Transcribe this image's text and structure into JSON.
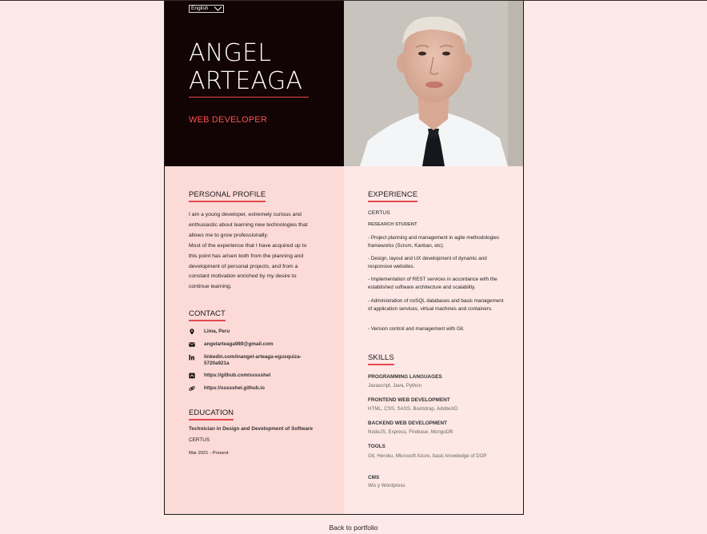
{
  "header": {
    "language": "English",
    "first_name": "ANGEL",
    "last_name": "ARTEAGA",
    "role": "WEB DEVELOPER"
  },
  "profile": {
    "title": "PERSONAL PROFILE",
    "lines": [
      "I am a young developer, extremely curious and",
      "enthusiastic about learning new technologies that",
      "allows me to grow professionally.",
      "Most of the experience that I have acquired up to",
      "this point has arisen both from the planning and",
      "development of personal projects, and from a",
      "constant motivation enriched by my desire to",
      "continue learning."
    ]
  },
  "contact": {
    "title": "CONTACT",
    "location": "Lima, Peru",
    "email": "angelarteaga989@gmail.com",
    "linkedin_line1": "linkedin.com/inangel-arteaga-egusquiza-",
    "linkedin_line2": "5720a921a",
    "github": "https://github.com/ssssshel",
    "website": "https://ssssshel.github.io"
  },
  "education": {
    "title": "EDUCATION",
    "degree": "Technician in Design and Development of Software",
    "school": "CERTUS",
    "dates": "Mar 2021 - Present"
  },
  "experience": {
    "title": "EXPERIENCE",
    "company": "CERTUS",
    "position": "RESEARCH STUDENT",
    "items": [
      "- Project planning and management in agile methodologies frameworks (Scrum, Kanban, etc).",
      "- Design, layout and UX development of dynamic and responsive websites.",
      "- Implementation of REST services in accordance with the established software architecture and scalability.",
      "- Administration of noSQL databases and basic management of application services, virtual machines and containers.",
      "- Version control and management with Git."
    ]
  },
  "skills": {
    "title": "SKILLS",
    "groups": [
      {
        "name": "PROGRAMMING LANGUAGES",
        "text": "Javascript, Java, Python"
      },
      {
        "name": "FRONTEND WEB DEVELOPMENT",
        "text": "HTML, CSS, SASS, Bootstrap, AdobeXD"
      },
      {
        "name": "BACKEND WEB DEVELOPMENT",
        "text": "NodeJS, Express, Firebase, MongoDB"
      },
      {
        "name": "TOOLS",
        "text": "Git, Heroku, Microsoft Azure, basic knowledge of DOP"
      },
      {
        "name": "CMS",
        "text": "Wix y Wordpress"
      }
    ]
  },
  "footer": {
    "back_link": "Back to portfolio"
  },
  "colors": {
    "accent": "#e5484d",
    "hero_dark": "#120304",
    "left_column": "#fcdad7",
    "right_column": "#fde8e6",
    "page_bg": "#fde9e7"
  }
}
